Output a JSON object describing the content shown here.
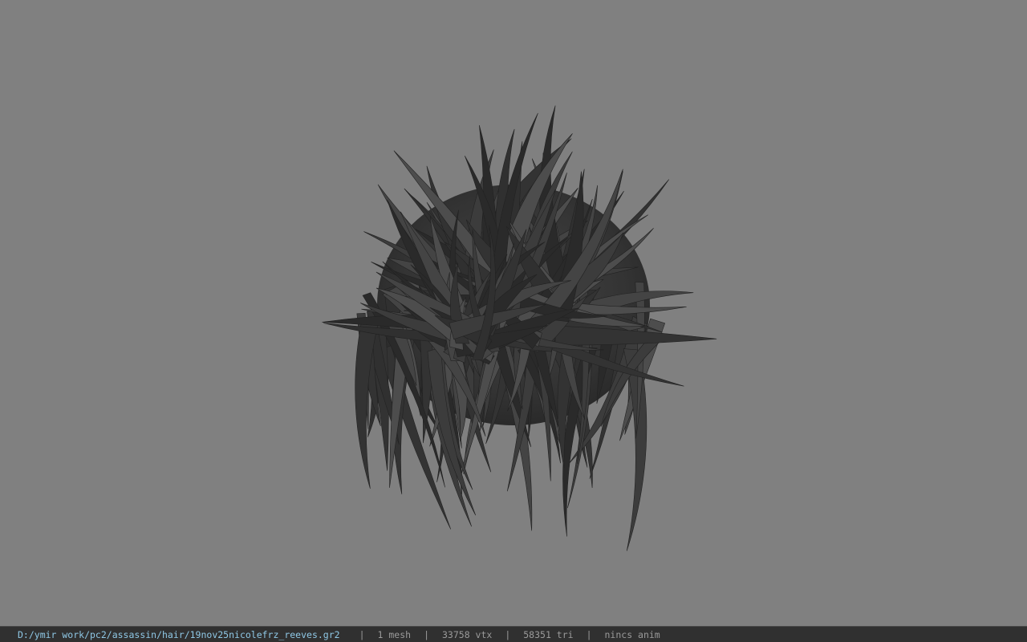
{
  "viewport": {
    "background_color": "#808080",
    "model_color": "#3a3a3a",
    "model_subject": "hair mesh"
  },
  "status_bar": {
    "file_path": "D:/ymir work/pc2/assassin/hair/19nov25nicolefrz_reeves.gr2",
    "separator": "|",
    "mesh_count": "1 mesh",
    "vertex_count": "33758 vtx",
    "triangle_count": "58351 tri",
    "anim_status": "nincs anim",
    "path_color": "#8fc8e6",
    "text_color": "#9a9a9a"
  }
}
